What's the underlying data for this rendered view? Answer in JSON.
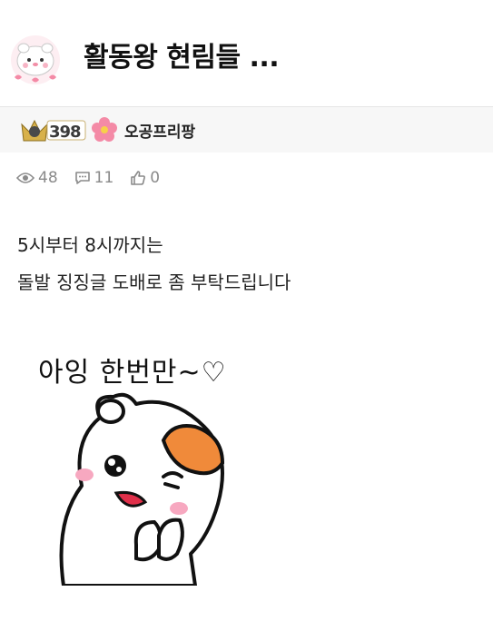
{
  "post": {
    "title": "활동왕 현림들 ..."
  },
  "author": {
    "level": "398",
    "nickname": "오공프리팡"
  },
  "stats": {
    "views": "48",
    "comments": "11",
    "likes": "0"
  },
  "content": {
    "lines": [
      "5시부터 8시까지는",
      "돌발 징징글 도배로 좀 부탁드립니다"
    ]
  },
  "sticker": {
    "caption": "아잉 한번만~♡"
  },
  "colors": {
    "accent_orange": "#f08a3a",
    "cheek_pink": "#f7a8c0",
    "bar_bg": "#f7f7f7"
  }
}
